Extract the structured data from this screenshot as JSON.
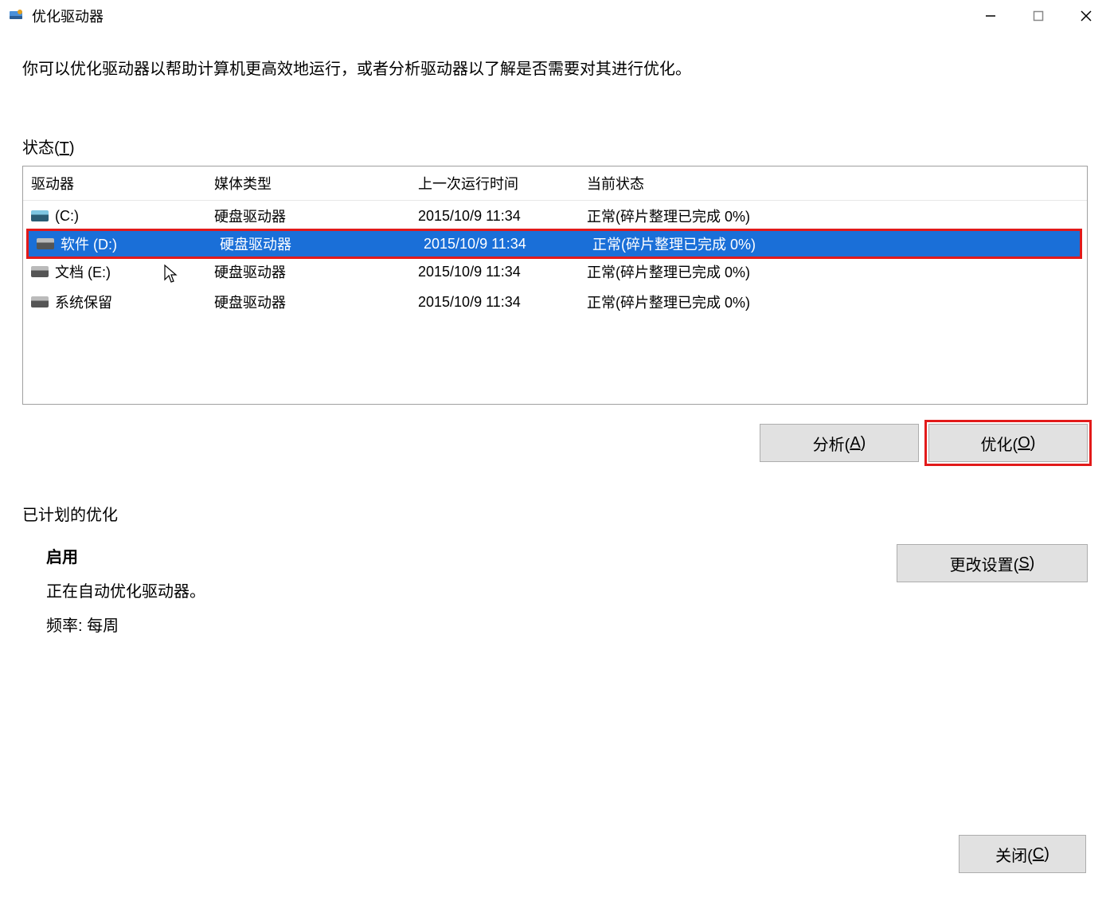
{
  "window": {
    "title": "优化驱动器"
  },
  "description": "你可以优化驱动器以帮助计算机更高效地运行，或者分析驱动器以了解是否需要对其进行优化。",
  "status_label_prefix": "状态(",
  "status_label_hotkey": "T",
  "status_label_suffix": ")",
  "columns": {
    "drive": "驱动器",
    "media": "媒体类型",
    "last": "上一次运行时间",
    "status": "当前状态"
  },
  "drives": [
    {
      "name": "(C:)",
      "media": "硬盘驱动器",
      "last": "2015/10/9 11:34",
      "status": "正常(碎片整理已完成 0%)",
      "icon": "sys",
      "selected": false
    },
    {
      "name": "软件 (D:)",
      "media": "硬盘驱动器",
      "last": "2015/10/9 11:34",
      "status": "正常(碎片整理已完成 0%)",
      "icon": "hdd",
      "selected": true
    },
    {
      "name": "文档 (E:)",
      "media": "硬盘驱动器",
      "last": "2015/10/9 11:34",
      "status": "正常(碎片整理已完成 0%)",
      "icon": "hdd",
      "selected": false
    },
    {
      "name": "系统保留",
      "media": "硬盘驱动器",
      "last": "2015/10/9 11:34",
      "status": "正常(碎片整理已完成 0%)",
      "icon": "hdd",
      "selected": false
    }
  ],
  "buttons": {
    "analyze_prefix": "分析(",
    "analyze_hotkey": "A",
    "analyze_suffix": ")",
    "optimize_prefix": "优化(",
    "optimize_hotkey": "O",
    "optimize_suffix": ")",
    "settings_prefix": "更改设置(",
    "settings_hotkey": "S",
    "settings_suffix": ")",
    "close_prefix": "关闭(",
    "close_hotkey": "C",
    "close_suffix": ")"
  },
  "scheduled": {
    "section_label": "已计划的优化",
    "title": "启用",
    "desc": "正在自动优化驱动器。",
    "freq": "频率: 每周"
  }
}
